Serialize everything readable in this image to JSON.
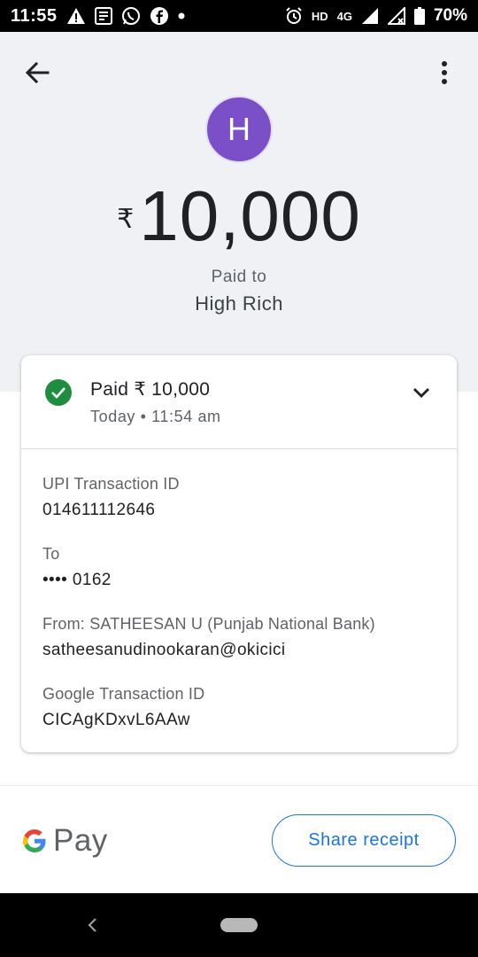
{
  "status_bar": {
    "time": "11:55",
    "network_label": "HD",
    "network_type": "4G",
    "battery": "70%",
    "left_icons": [
      "warning-icon",
      "news-icon",
      "whatsapp-icon",
      "facebook-icon",
      "dot-icon"
    ],
    "right_icons": [
      "alarm-icon",
      "signal-icon",
      "signal-2-icon",
      "battery-icon"
    ]
  },
  "header": {
    "avatar_letter": "H",
    "avatar_color": "#7b4fc7",
    "currency_symbol": "₹",
    "amount": "10,000",
    "paid_to_label": "Paid to",
    "payee_name": "High Rich"
  },
  "card": {
    "status_title": "Paid ₹ 10,000",
    "status_time": "Today • 11:54 am",
    "status_color": "#1e8e3e",
    "details": [
      {
        "label": "UPI Transaction ID",
        "value": "014611112646"
      },
      {
        "label": "To",
        "value": "•••• 0162"
      },
      {
        "label": "From: SATHEESAN U (Punjab National Bank)",
        "value": "satheesanudinookaran@okicici"
      },
      {
        "label": "Google Transaction ID",
        "value": "CICAgKDxvL6AAw"
      }
    ]
  },
  "bottom": {
    "brand_text": "Pay",
    "share_label": "Share receipt",
    "accent": "#1a73e8"
  }
}
